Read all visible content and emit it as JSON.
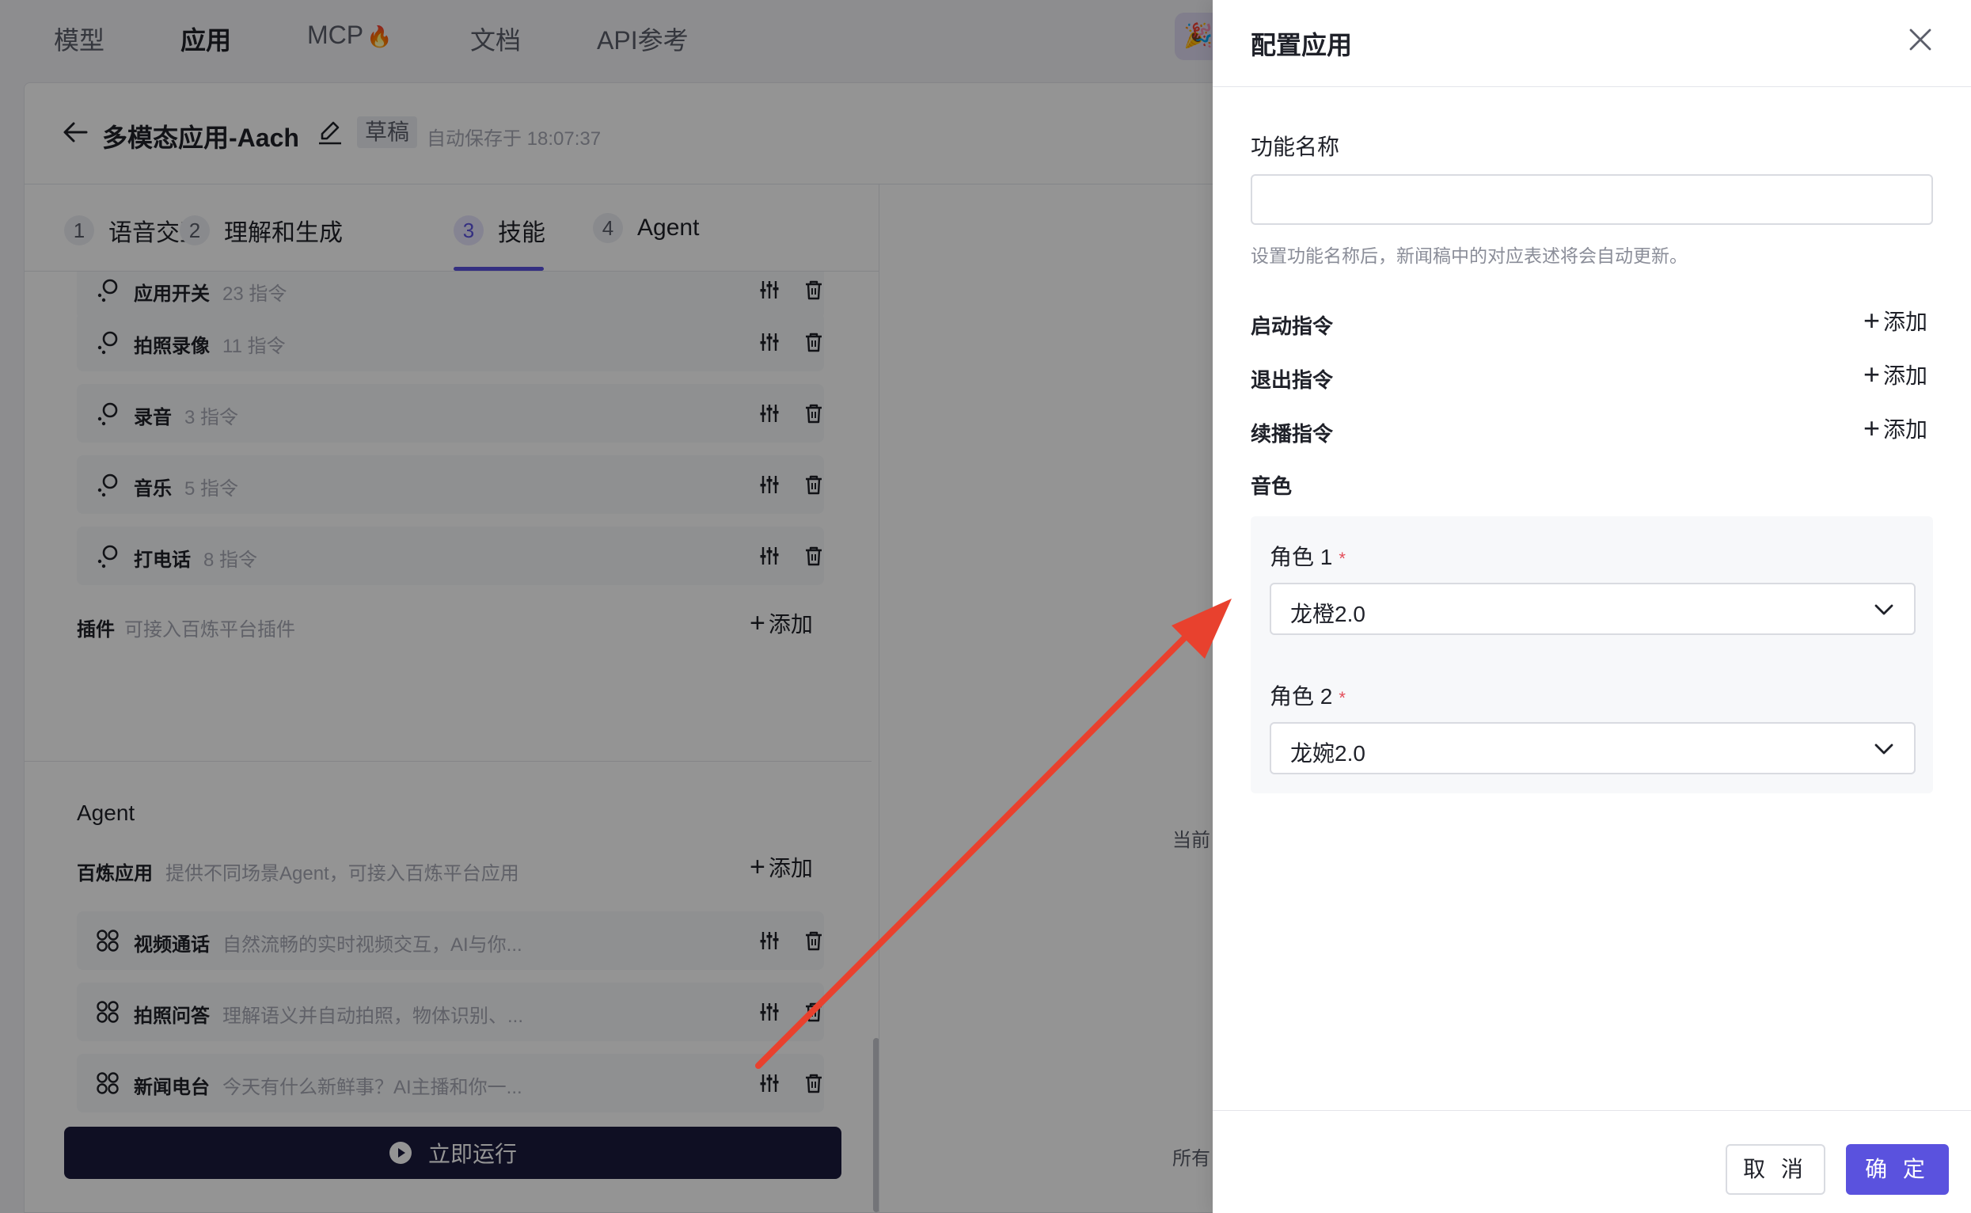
{
  "topnav": {
    "items": [
      "模型",
      "应用",
      "MCP",
      "文档",
      "API参考"
    ],
    "active_index": 1,
    "mcp_emoji": "🔥",
    "badge_emoji": "🎉"
  },
  "app": {
    "title": "多模态应用-Aach",
    "status_badge": "草稿",
    "autosave": "自动保存于 18:07:37"
  },
  "tabs": [
    {
      "num": "1",
      "label": "语音交互"
    },
    {
      "num": "2",
      "label": "理解和生成"
    },
    {
      "num": "3",
      "label": "技能"
    },
    {
      "num": "4",
      "label": "Agent"
    }
  ],
  "skills": [
    {
      "name": "应用开关",
      "count": "23 指令"
    },
    {
      "name": "拍照录像",
      "count": "11 指令"
    },
    {
      "name": "录音",
      "count": "3 指令"
    },
    {
      "name": "音乐",
      "count": "5 指令"
    },
    {
      "name": "打电话",
      "count": "8 指令"
    }
  ],
  "plugins": {
    "label": "插件",
    "hint": "可接入百炼平台插件",
    "add_label": "添加"
  },
  "agent_section": {
    "heading": "Agent",
    "label": "百炼应用",
    "hint": "提供不同场景Agent，可接入百炼平台应用",
    "add_label": "添加",
    "apps": [
      {
        "name": "视频通话",
        "desc": "自然流畅的实时视频交互，AI与你..."
      },
      {
        "name": "拍照问答",
        "desc": "理解语义并自动拍照，物体识别、..."
      },
      {
        "name": "新闻电台",
        "desc": "今天有什么新鲜事？AI主播和你一..."
      }
    ]
  },
  "run_button": "立即运行",
  "right_hints": {
    "top": "当前",
    "bottom": "所有"
  },
  "drawer": {
    "title": "配置应用",
    "name_label": "功能名称",
    "name_value": "",
    "name_help": "设置功能名称后，新闻稿中的对应表述将会自动更新。",
    "commands": [
      {
        "label": "启动指令",
        "add": "添加"
      },
      {
        "label": "退出指令",
        "add": "添加"
      },
      {
        "label": "续播指令",
        "add": "添加"
      }
    ],
    "voice_label": "音色",
    "roles": [
      {
        "label": "角色 1",
        "required": "*",
        "value": "龙橙2.0"
      },
      {
        "label": "角色 2",
        "required": "*",
        "value": "龙婉2.0"
      }
    ],
    "cancel": "取 消",
    "ok": "确 定"
  },
  "colors": {
    "accent": "#5a52de",
    "run_button": "#1b1a3d",
    "annotation_arrow": "#e8412e"
  }
}
